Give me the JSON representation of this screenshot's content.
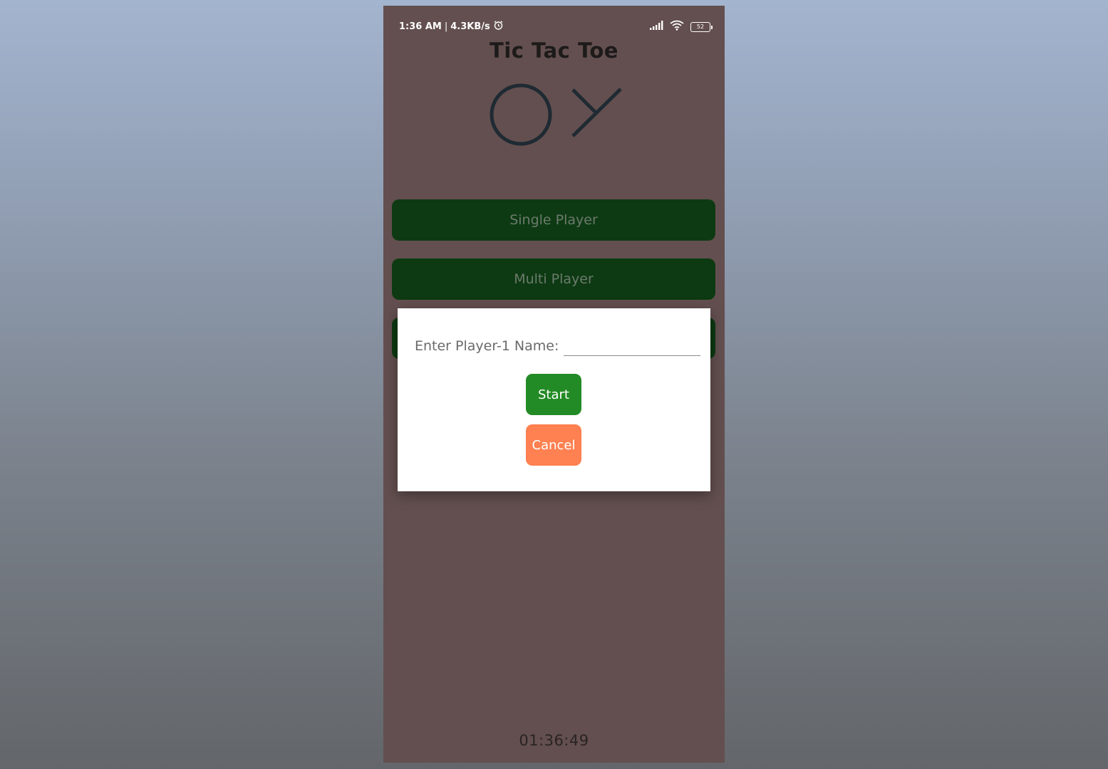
{
  "status_bar": {
    "time": "1:36 AM",
    "separator": "|",
    "network_speed": "4.3KB/s",
    "alarm_icon": "alarm-clock-icon",
    "signal_icon": "cellular-signal-icon",
    "wifi_icon": "wifi-icon",
    "battery_level": "52"
  },
  "app": {
    "title": "Tic Tac Toe",
    "logo_icons": [
      "circle-o-icon",
      "x-mark-icon"
    ],
    "menu": {
      "single_player": "Single Player",
      "multi_player": "Multi Player"
    },
    "clock": "01:36:49"
  },
  "dialog": {
    "prompt": "Enter Player-1 Name:",
    "name_value": "",
    "start_label": "Start",
    "cancel_label": "Cancel"
  },
  "colors": {
    "screen_background": "#634f4f",
    "menu_button": "#0d3a12",
    "start_button": "#238b25",
    "cancel_button": "#ff8050",
    "dialog_background": "#ffffff"
  }
}
